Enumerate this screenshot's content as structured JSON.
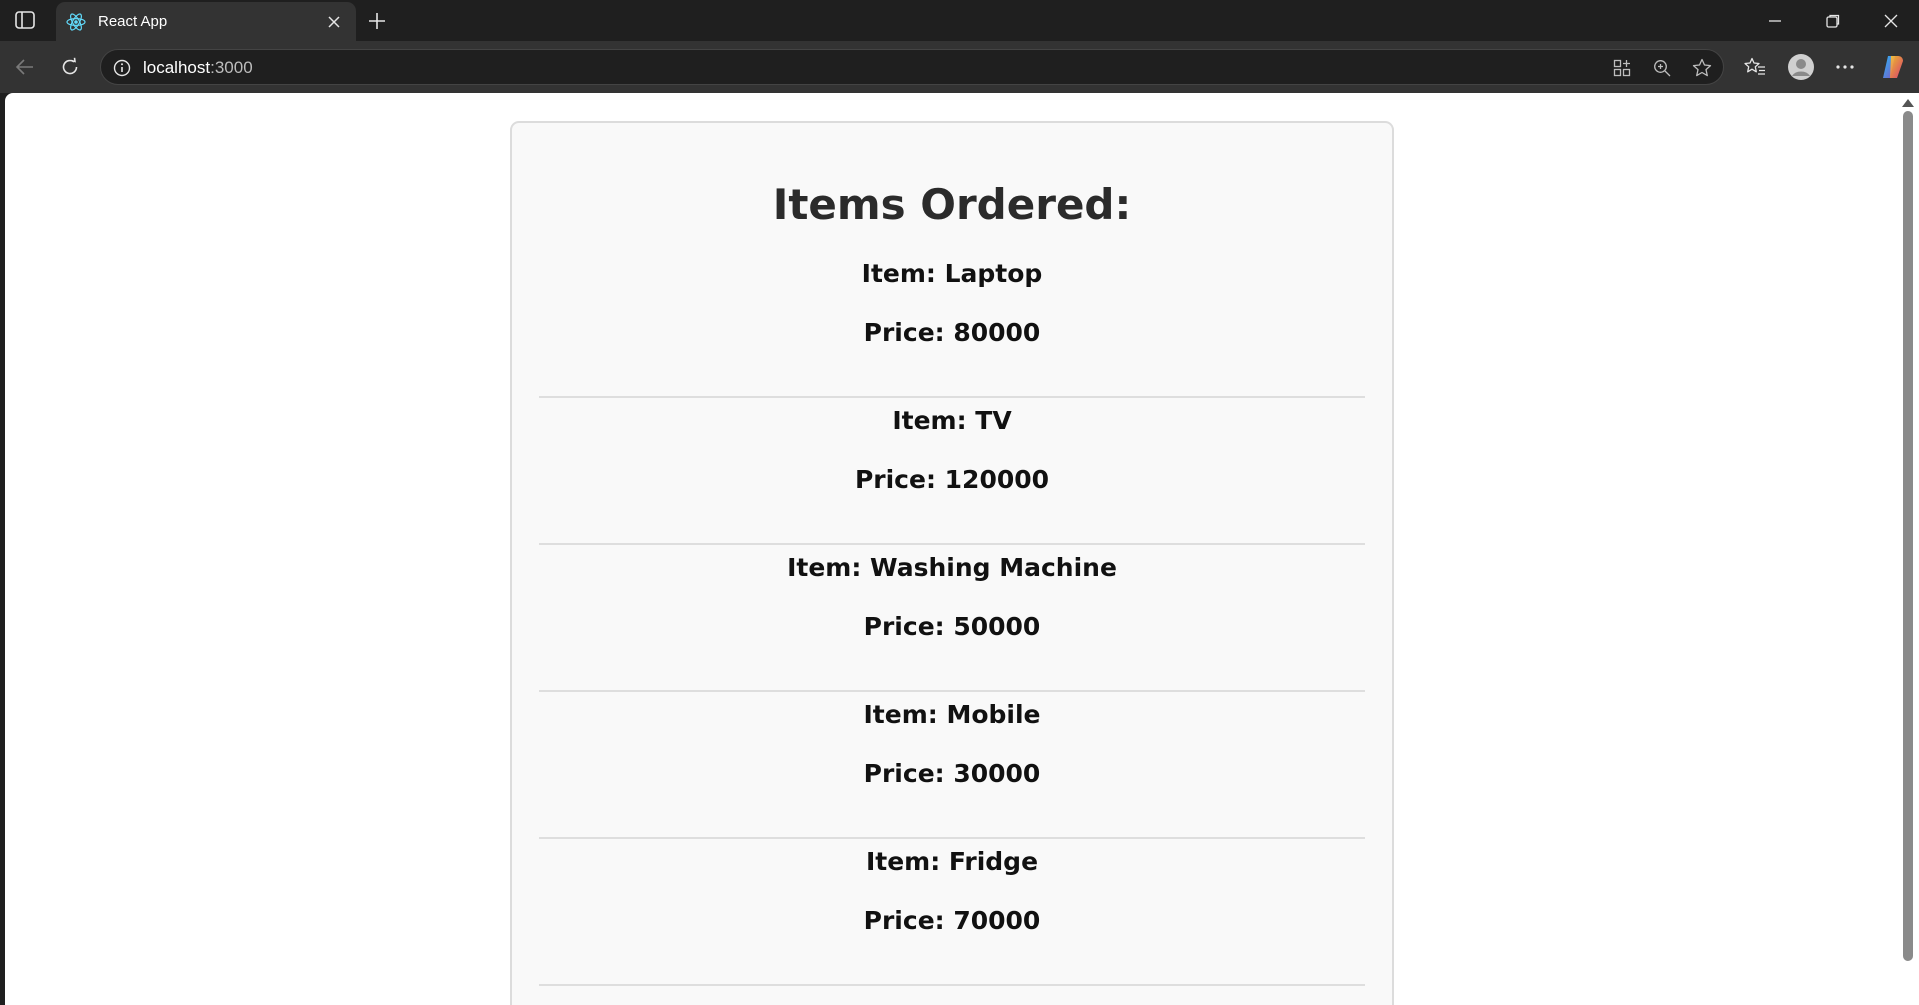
{
  "browser": {
    "tab_title": "React App",
    "url_host": "localhost",
    "url_port": ":3000"
  },
  "page": {
    "heading": "Items Ordered:",
    "orders": [
      {
        "item": "Item: Laptop",
        "price": "Price: 80000"
      },
      {
        "item": "Item: TV",
        "price": "Price: 120000"
      },
      {
        "item": "Item: Washing Machine",
        "price": "Price: 50000"
      },
      {
        "item": "Item: Mobile",
        "price": "Price: 30000"
      },
      {
        "item": "Item: Fridge",
        "price": "Price: 70000"
      }
    ]
  },
  "icons": {
    "sidebar": "sidebar-toggle-icon",
    "favicon": "react-icon",
    "tab_close": "close-icon",
    "new_tab": "plus-icon",
    "back": "back-arrow-icon",
    "refresh": "refresh-icon",
    "site_info": "info-icon",
    "app_available": "app-grid-icon",
    "zoom": "zoom-icon",
    "favorite": "star-icon",
    "favorites": "favorites-icon",
    "profile": "profile-icon",
    "more": "more-icon",
    "copilot": "copilot-icon"
  },
  "colors": {
    "chrome_dark": "#1f1f1f",
    "toolbar": "#333333",
    "card_bg": "#f9f9f9",
    "card_border": "#dcdcdc"
  }
}
